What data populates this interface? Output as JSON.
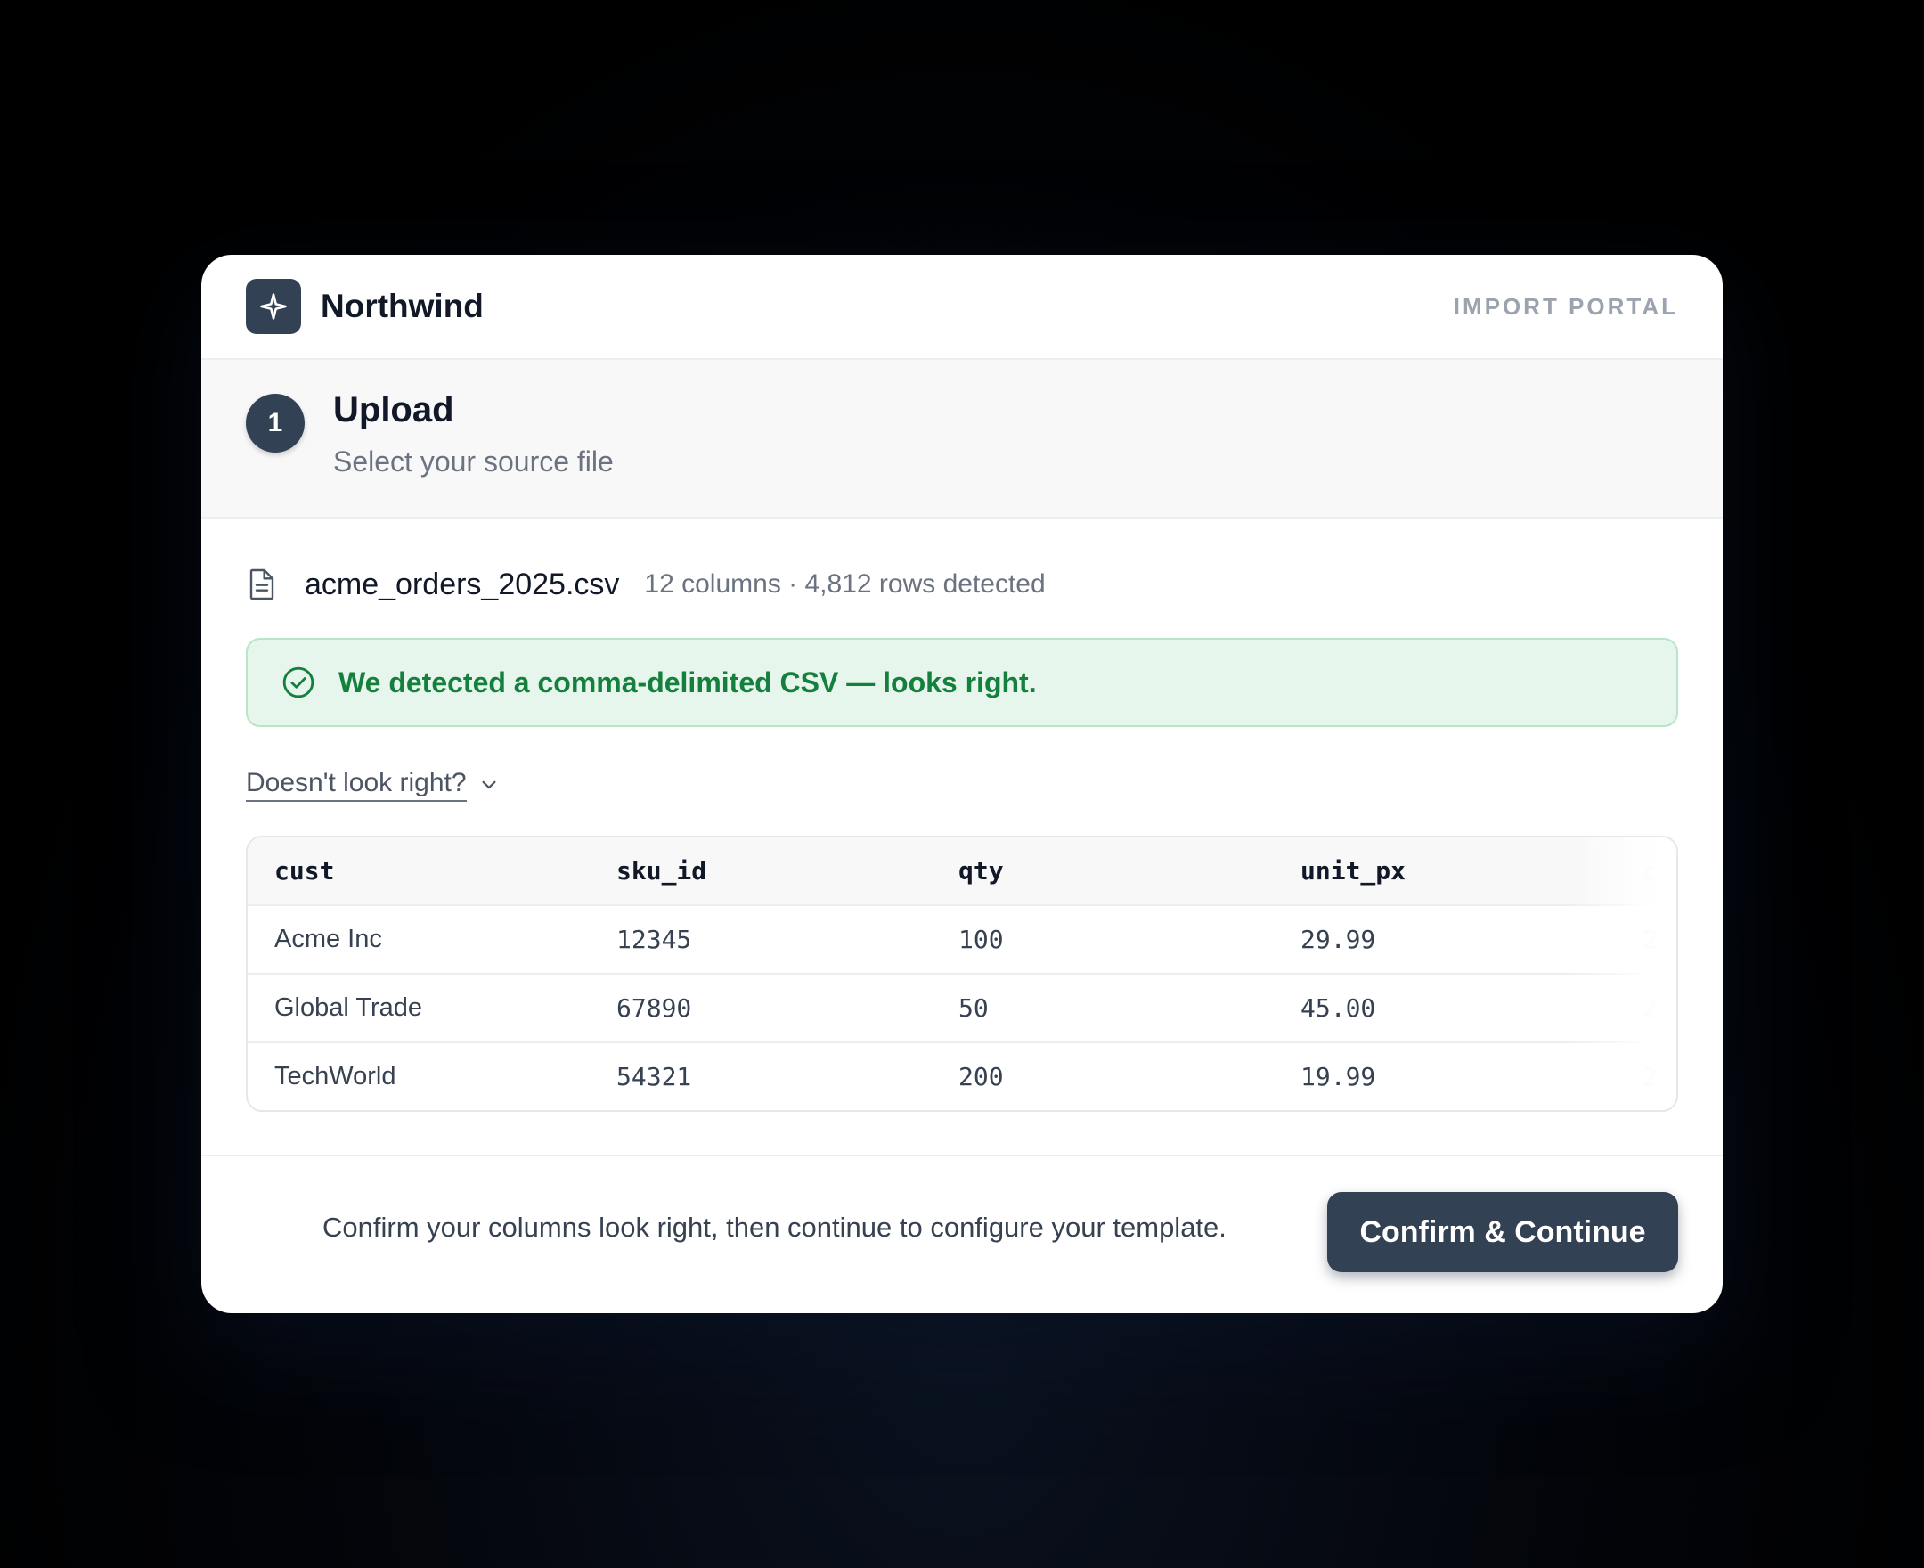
{
  "header": {
    "brand": "Northwind",
    "portal_label": "IMPORT PORTAL",
    "logo_icon": "sparkle-icon"
  },
  "step": {
    "number": "1",
    "title": "Upload",
    "subtitle": "Select your source file"
  },
  "file": {
    "icon": "file-icon",
    "name": "acme_orders_2025.csv",
    "meta": "12 columns · 4,812 rows detected"
  },
  "alert": {
    "icon": "check-circle-icon",
    "message": "We detected a comma-delimited CSV — looks right.",
    "color": "#15803d"
  },
  "toggle": {
    "label": "Doesn't look right?",
    "icon": "chevron-down-icon"
  },
  "table": {
    "headers": [
      "cust",
      "sku_id",
      "qty",
      "unit_px",
      "c"
    ],
    "rows": [
      [
        "Acme Inc",
        "12345",
        "100",
        "29.99",
        "2"
      ],
      [
        "Global Trade",
        "67890",
        "50",
        "45.00",
        "2"
      ],
      [
        "TechWorld",
        "54321",
        "200",
        "19.99",
        "2"
      ]
    ]
  },
  "footer": {
    "hint": "Confirm your columns look right, then continue to configure your template.",
    "cta_label": "Confirm & Continue"
  },
  "colors": {
    "accent": "#334155",
    "success_bg": "#e7f6ec",
    "success_text": "#15803d"
  }
}
